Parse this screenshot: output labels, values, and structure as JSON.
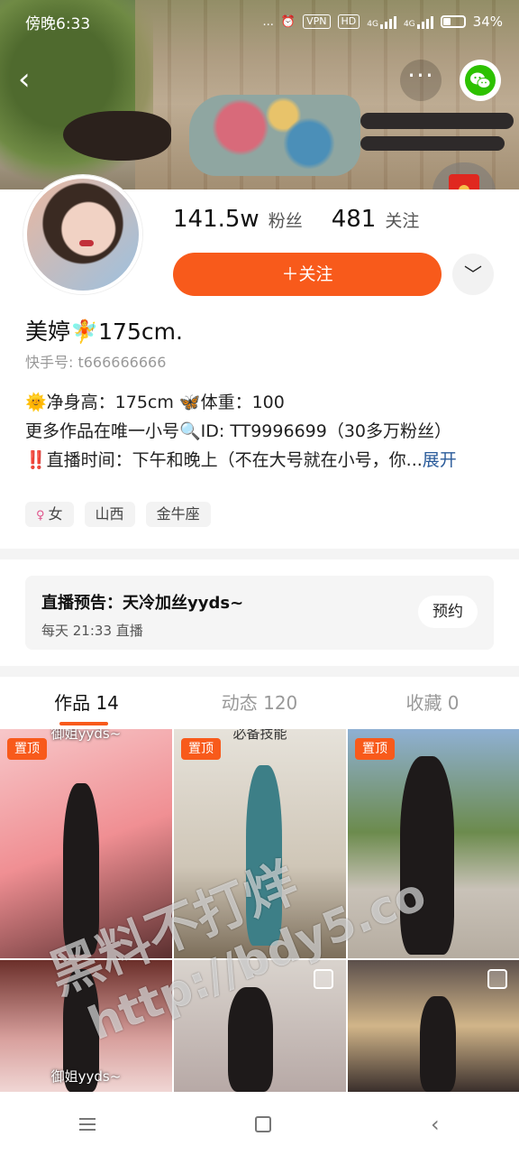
{
  "status_bar": {
    "time": "傍晚6:33",
    "dots": "...",
    "vpn": "VPN",
    "hd": "HD",
    "net1": "4G",
    "net2": "4G",
    "battery": "34%"
  },
  "header": {
    "back_icon": "chevron-left-icon",
    "more_icon": "more-icon",
    "share_icon": "wechat-icon",
    "redpacket_icon": "red-packet-icon"
  },
  "profile": {
    "followers_count": "141.5w",
    "followers_label": "粉丝",
    "following_count": "481",
    "following_label": "关注",
    "follow_button": "＋关注",
    "dropdown_icon": "chevron-down-icon",
    "name": "美婷🧚175cm.",
    "user_id": "快手号: t666666666",
    "bio_line1": "🌞净身高：175cm   🦋体重：100",
    "bio_line2": "更多作品在唯一小号🔍ID: TT9996699（30多万粉丝）",
    "bio_line3": "‼️直播时间：下午和晚上（不在大号就在小号，你...",
    "bio_expand": "展开",
    "tags": [
      {
        "symbol": "♀",
        "label": "女"
      },
      {
        "symbol": "",
        "label": "山西"
      },
      {
        "symbol": "",
        "label": "金牛座"
      }
    ]
  },
  "live": {
    "title": "直播预告：天冷加丝yyds~",
    "schedule": "每天 21:33 直播",
    "reserve_button": "预约"
  },
  "tabs": [
    {
      "label": "作品 14",
      "active": true
    },
    {
      "label": "动态 120",
      "active": false
    },
    {
      "label": "收藏 0",
      "active": false
    }
  ],
  "grid": {
    "pin_label": "置顶",
    "cell1_caption": "御姐yyds~",
    "cell2_caption": "必备技能",
    "cell4_caption": "御姐yyds~"
  },
  "watermark": {
    "line1": "黑料不打烊",
    "line2": "http://bdy5.co"
  },
  "nav": {
    "menu_icon": "menu-icon",
    "home_icon": "square-icon",
    "back_icon": "back-triangle-icon"
  },
  "colors": {
    "accent": "#f85a1b",
    "link": "#2a5b9a"
  }
}
